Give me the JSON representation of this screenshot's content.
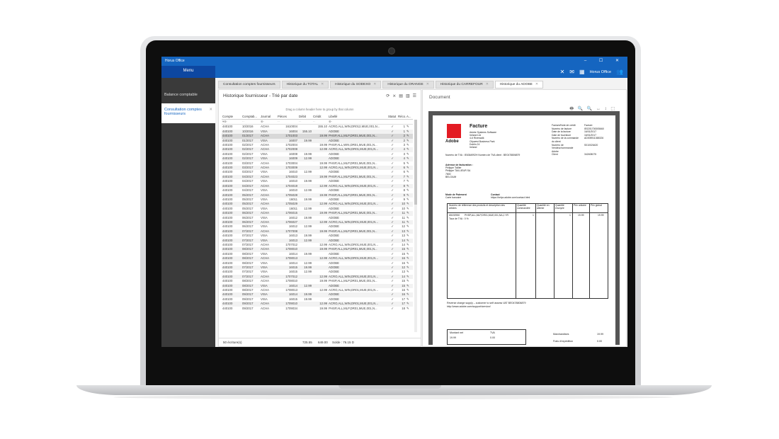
{
  "window": {
    "title": "Horus Office",
    "controls": "–  ☐  ✕"
  },
  "topbar": {
    "menu_label": "Menu",
    "app_name": "Horus Office"
  },
  "sidebar": {
    "items": [
      {
        "label": "Balance comptable"
      },
      {
        "label": "Consultation comptes fournisseurs"
      }
    ]
  },
  "tabs": [
    {
      "label": "Consultation comptes fournisseurs"
    },
    {
      "label": "Historique du TOTAL"
    },
    {
      "label": "Historique du SODEXO"
    },
    {
      "label": "Historique du ORANGE"
    },
    {
      "label": "Historique du CARREFOUR"
    },
    {
      "label": "Historique du ADOBE"
    }
  ],
  "grid": {
    "title": "Historique fournisseur - Trié par date",
    "group_hint": "Drag a column header here to group by that column",
    "columns": [
      "Compte",
      "Comptab...",
      "Journal",
      "Pièces",
      "Débit",
      "Crédit",
      "Libellé",
      "Statut",
      "Réco...",
      "A..."
    ],
    "rows": [
      [
        "440100",
        "10/2016",
        "ACHA",
        "1610004",
        "",
        "155.10",
        "ACRO,ALL,WIN,DR012,MUE,001,N...",
        "1"
      ],
      [
        "440100",
        "10/2016",
        "VISA",
        "16004",
        "155.10",
        "",
        "ADOBE",
        "1"
      ],
      [
        "440100",
        "01/2017",
        "ACHA",
        "1701003",
        "",
        "19.99",
        "PHSP,ALL,MLP,DR01,MUE,001,N...",
        "2"
      ],
      [
        "440100",
        "01/2017",
        "VISA",
        "16007",
        "19.99",
        "",
        "ADOBE",
        "2"
      ],
      [
        "440100",
        "02/2017",
        "ACHA",
        "1702004",
        "",
        "19.99",
        "PHSP,ALL,WIN,DR01,MUE,001,N...",
        "3"
      ],
      [
        "440100",
        "02/2017",
        "ACHA",
        "1702008",
        "",
        "12.99",
        "ACRO,ALL,WIN,DR01,MUE,001,N...",
        "4"
      ],
      [
        "440100",
        "02/2017",
        "VISA",
        "16008",
        "19.99",
        "",
        "ADOBE",
        "3"
      ],
      [
        "440100",
        "02/2017",
        "VISA",
        "16009",
        "12.99",
        "",
        "ADOBE",
        "4"
      ],
      [
        "440100",
        "03/2017",
        "ACHA",
        "1703004",
        "",
        "19.99",
        "PHSP,ALL,MLP,DR01,MUE,001,N...",
        "5"
      ],
      [
        "440100",
        "03/2017",
        "ACHA",
        "1703009",
        "",
        "12.99",
        "ACRO,ALL,WIN,DR01,MUE,001,N...",
        "6"
      ],
      [
        "440100",
        "03/2017",
        "VISA",
        "16010",
        "12.99",
        "",
        "ADOBE",
        "6"
      ],
      [
        "440100",
        "04/2017",
        "ACHA",
        "1704023",
        "",
        "19.99",
        "PHSP,ALL,MLP,DR01,MUE,001,N...",
        "7"
      ],
      [
        "440100",
        "04/2017",
        "VISA",
        "16010",
        "19.99",
        "",
        "ADOBE",
        "7"
      ],
      [
        "440100",
        "04/2017",
        "ACHA",
        "1704019",
        "",
        "12.99",
        "ACRO,ALL,WIN,DR01,MUE,001,N...",
        "8"
      ],
      [
        "440100",
        "04/2017",
        "VISA",
        "16010",
        "12.99",
        "",
        "ADOBE",
        "8"
      ],
      [
        "440100",
        "05/2017",
        "ACHA",
        "1705028",
        "",
        "19.99",
        "PHSP,ALL,MLP,DR01,MUE,001,N...",
        "9"
      ],
      [
        "440100",
        "05/2017",
        "VISA",
        "16011",
        "19.99",
        "",
        "ADOBE",
        "9"
      ],
      [
        "440100",
        "05/2017",
        "ACHA",
        "1705029",
        "",
        "12.99",
        "ACRO,ALL,WIN,DR01,MUE,001,N...",
        "10"
      ],
      [
        "440100",
        "05/2017",
        "VISA",
        "16011",
        "12.99",
        "",
        "ADOBE",
        "10"
      ],
      [
        "440100",
        "06/2017",
        "ACHA",
        "1706015",
        "",
        "19.99",
        "PHSP,ALL,MLP,DR01,MUE,001,N...",
        "11"
      ],
      [
        "440100",
        "06/2017",
        "VISA",
        "16012",
        "19.99",
        "",
        "ADOBE",
        "11"
      ],
      [
        "440100",
        "06/2017",
        "ACHA",
        "1706027",
        "",
        "12.99",
        "ACRO,ALL,WIN,DR01,MUE,001,N...",
        "11"
      ],
      [
        "440100",
        "06/2017",
        "VISA",
        "16012",
        "12.99",
        "",
        "ADOBE",
        "12"
      ],
      [
        "440100",
        "07/2017",
        "ACHA",
        "1707008",
        "",
        "19.99",
        "PHSP,ALL,MLP,DR01,MUE,001,N...",
        "13"
      ],
      [
        "440100",
        "07/2017",
        "VISA",
        "16013",
        "19.99",
        "",
        "ADOBE",
        "13"
      ],
      [
        "440100",
        "07/2017",
        "VISA",
        "16013",
        "12.99",
        "",
        "ADOBE",
        "14"
      ],
      [
        "440100",
        "07/2017",
        "ACHA",
        "1707012",
        "",
        "12.99",
        "ACRO,ALL,WIN,DR01,MUE,001,N...",
        "14"
      ],
      [
        "440100",
        "08/2017",
        "ACHA",
        "1708010",
        "",
        "19.99",
        "PHSP,ALL,MLP,DR01,MUE,001,N...",
        "15"
      ],
      [
        "440100",
        "08/2017",
        "VISA",
        "16014",
        "19.99",
        "",
        "ADOBE",
        "15"
      ],
      [
        "440100",
        "08/2017",
        "ACHA",
        "1708013",
        "",
        "12.99",
        "ACRO,ALL,WIN,DR01,MUE,001,N...",
        "16"
      ],
      [
        "440100",
        "08/2017",
        "VISA",
        "16014",
        "12.99",
        "",
        "ADOBE",
        "16"
      ],
      [
        "440100",
        "07/2017",
        "VISA",
        "16015",
        "19.99",
        "",
        "ADOBE",
        "12"
      ],
      [
        "440100",
        "07/2017",
        "VISA",
        "16015",
        "12.99",
        "",
        "ADOBE",
        "13"
      ],
      [
        "440100",
        "07/2017",
        "ACHA",
        "1707012",
        "",
        "12.99",
        "ACRO,ALL,WIN,DR01,MUE,001,N...",
        "14"
      ],
      [
        "440100",
        "08/2017",
        "ACHA",
        "1708010",
        "",
        "19.99",
        "PHSP,ALL,MLP,DR01,MUE,001,N...",
        "15"
      ],
      [
        "440100",
        "08/2017",
        "VISA",
        "16014",
        "12.99",
        "",
        "ADOBE",
        "15"
      ],
      [
        "440100",
        "08/2017",
        "ACHA",
        "1708013",
        "",
        "12.99",
        "ACRO,ALL,WIN,DR01,MUE,001,N...",
        "16"
      ],
      [
        "440100",
        "09/2017",
        "VISA",
        "16014",
        "19.99",
        "",
        "ADOBE",
        "16"
      ],
      [
        "440100",
        "09/2017",
        "VISA",
        "16015",
        "19.99",
        "",
        "ADOBE",
        "17"
      ],
      [
        "440100",
        "09/2017",
        "ACHA",
        "1709010",
        "",
        "12.99",
        "ACRO,ALL,WIN,DR01,MUE,001,N...",
        "17"
      ],
      [
        "440100",
        "09/2017",
        "ACHA",
        "1709034",
        "",
        "19.99",
        "PHSP,ALL,MLP,DR01,MUE,001,N...",
        "18"
      ]
    ],
    "selected_row": 2,
    "footer": {
      "count": "50 écriture(s)",
      "debit_total": "725.55",
      "credit_total": "649.00",
      "solde": "Solde : 76.15 D"
    }
  },
  "document": {
    "title": "Document",
    "tools": "🖶 🔍 🔍 ↔ ↕ ⬚",
    "invoice": {
      "heading": "Facture",
      "logo_text": "Adobe",
      "address": [
        "Adobe Systems Software",
        "Ireland Ltd",
        "4-6 Riverwalk",
        "Citywest Business Park",
        "Dublin 24",
        "Ireland"
      ],
      "right_fields": [
        [
          "Facture/Note de crédit",
          "Facture"
        ],
        [
          "Numéro de facture",
          "IE0201700005660"
        ],
        [
          "Date de la facture",
          "16/01/2017"
        ],
        [
          "Date de fourniture",
          "16/01/2017"
        ],
        [
          "Numéro de la commande du client",
          "AD005911365326"
        ],
        [
          "Numéro de Vendeur/commande Adobe",
          "S010026420"
        ],
        [
          "Client",
          "342408075"
        ]
      ],
      "vat_line": "Numéro de TVA : IE6364992H  Numéro de TVA client : BE0478806879",
      "bill_to": [
        "Adresse de facturation :",
        "Philippe Toillier",
        "Philippe TAILLIEUR SA",
        "7800",
        "BELGIUM"
      ],
      "payment": [
        "Mode de Paiement",
        "Carte bancaire"
      ],
      "contact": [
        "Contact",
        "https://helpx.adobe.com/contact.html"
      ],
      "table_headers": [
        "Numéro de référence des produits et description des articles",
        "Quantité commandée",
        "Quantité en attente",
        "Quantité envoyée",
        "Prix unitaire",
        "Prix global"
      ],
      "line_item": [
        "65192950",
        "PHSP,ALL,MLP,DR01,MUE,001,NA,1 YR",
        "1",
        "1",
        "19.99",
        "19.99"
      ],
      "line_item_note": "Taux de TVA : 0 %",
      "reverse_charge": "Reverse charge supply – customer to self assess VAT  BE0478806879",
      "support_url": "http://www.adobe.com/support/service/",
      "totals_labels": [
        "Montant net",
        "TVA"
      ],
      "totals_values": [
        "19.99",
        "0.00"
      ],
      "merch_labels": [
        "Marchandises",
        "Frais d'expédition"
      ],
      "merch_values": [
        "19.99",
        "0.00"
      ]
    }
  }
}
